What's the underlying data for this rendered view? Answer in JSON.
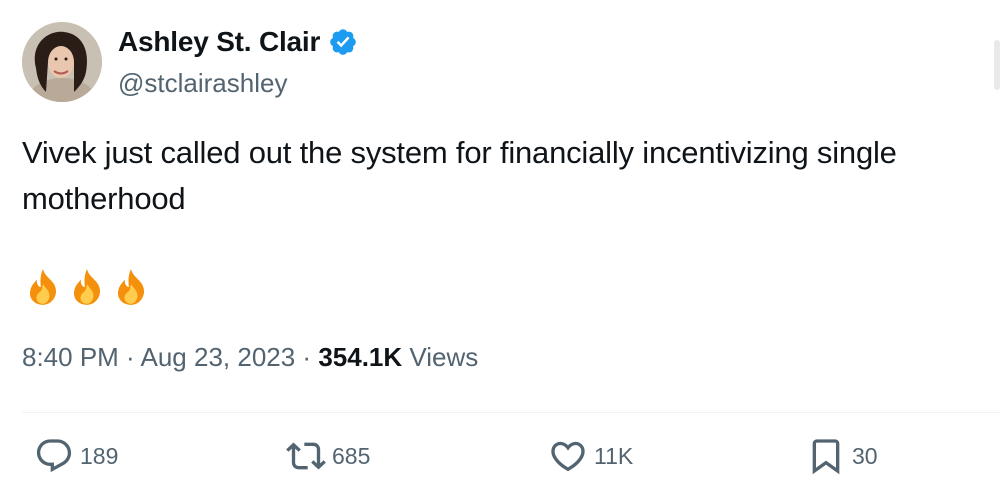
{
  "author": {
    "display_name": "Ashley St. Clair",
    "handle": "@stclairashley",
    "verified": true,
    "avatar_icon": "profile-photo"
  },
  "tweet": {
    "text": "Vivek just called out the system for financially incentivizing single motherhood",
    "emojis": [
      "fire",
      "fire",
      "fire"
    ]
  },
  "meta": {
    "time": "8:40 PM",
    "separator": " · ",
    "date": "Aug 23, 2023",
    "views_count": "354.1K",
    "views_label": " Views"
  },
  "actions": {
    "replies": "189",
    "reposts": "685",
    "likes": "11K",
    "bookmarks": "30"
  },
  "colors": {
    "verified_blue": "#1d9bf0",
    "secondary_text": "#536471",
    "primary_text": "#0f1419"
  }
}
